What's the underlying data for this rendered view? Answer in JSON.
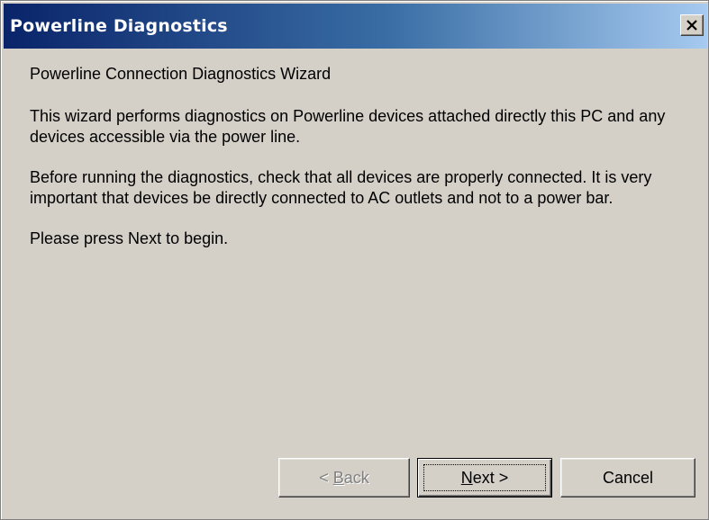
{
  "window": {
    "title": "Powerline Diagnostics"
  },
  "titlebar": {
    "close_icon": "close-icon"
  },
  "content": {
    "heading": "Powerline Connection Diagnostics Wizard",
    "paragraph_1": "This wizard performs diagnostics on Powerline devices attached directly this PC and any devices accessible via the power line.",
    "paragraph_2": "Before running the diagnostics, check that all devices are properly connected. It is very important that devices be directly connected to AC outlets and not to a power bar.",
    "paragraph_3": "Please press Next to begin."
  },
  "buttons": {
    "back_prefix": "< ",
    "back_mnemonic": "B",
    "back_rest": "ack",
    "next_mnemonic": "N",
    "next_rest": "ext >",
    "cancel": "Cancel"
  },
  "colors": {
    "title_gradient_start": "#0a246a",
    "title_gradient_end": "#a6caf0",
    "window_bg": "#d4d0c8",
    "disabled_text": "#808080"
  }
}
